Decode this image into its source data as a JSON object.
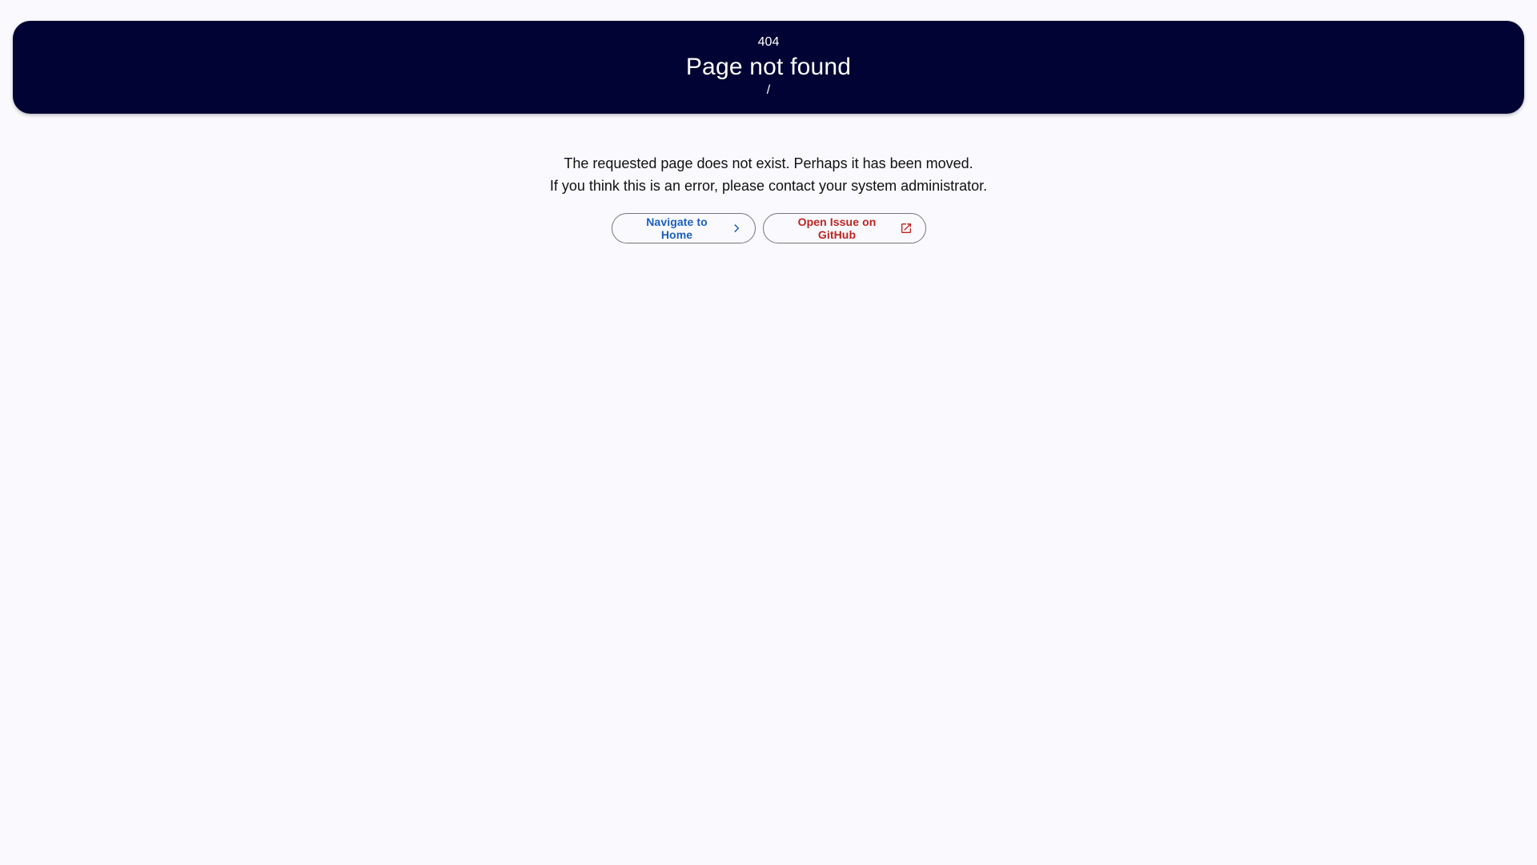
{
  "banner": {
    "code": "404",
    "title": "Page not found",
    "path": "/"
  },
  "message": {
    "line1": "The requested page does not exist. Perhaps it has been moved.",
    "line2": "If you think this is an error, please contact your system administrator."
  },
  "actions": {
    "home": {
      "label": "Navigate to Home",
      "icon": "chevron-right-icon",
      "color": "#1b5fbf"
    },
    "issue": {
      "label": "Open Issue on GitHub",
      "icon": "open-in-new-icon",
      "color": "#c0231f"
    }
  },
  "colors": {
    "banner_background": "#000333",
    "page_background": "#f9f9fe",
    "button_border": "#777680"
  }
}
